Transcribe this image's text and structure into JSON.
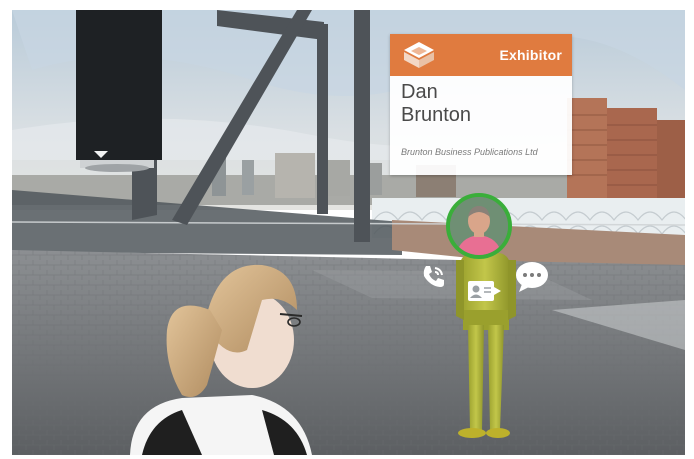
{
  "exhibitor_card": {
    "role_label": "Exhibitor",
    "first_name": "Dan",
    "last_name": "Brunton",
    "company": "Brunton Business Publications Ltd",
    "accent_color": "#e07b3f"
  },
  "avatar": {
    "icon": "user-photo",
    "ring_color": "#3aae3a"
  },
  "actions": [
    {
      "icon": "phone-call-icon"
    },
    {
      "icon": "business-card-icon"
    },
    {
      "icon": "chat-bubble-icon"
    }
  ]
}
